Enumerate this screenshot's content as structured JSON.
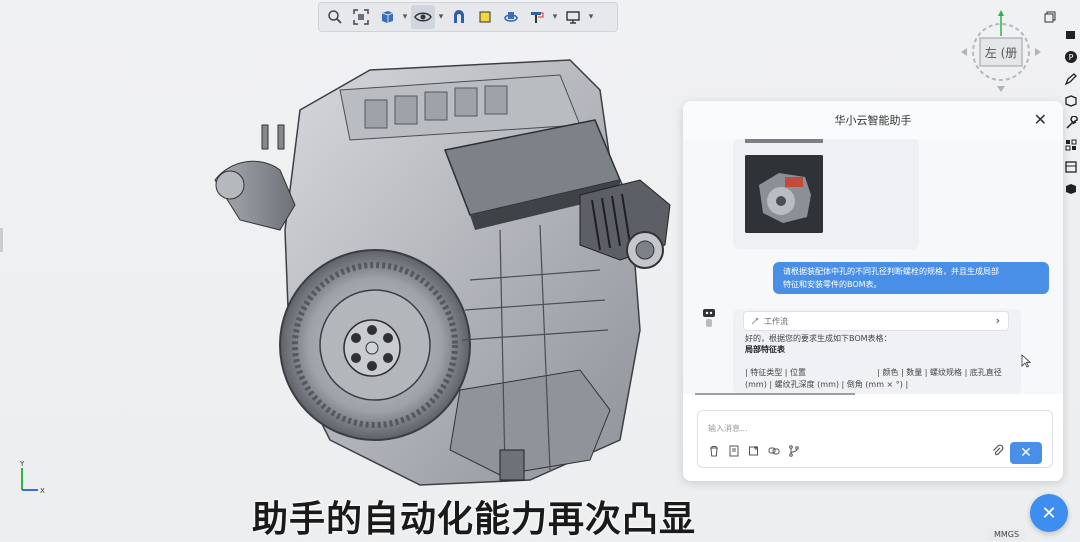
{
  "toolbar": {
    "icons": [
      "zoom-icon",
      "fit-view-icon",
      "cube-view-icon",
      "eye-icon",
      "section-icon",
      "face-icon",
      "rotate-icon",
      "paint-icon",
      "display-icon"
    ]
  },
  "viewcube": {
    "label": "左 (册"
  },
  "axis": {
    "y": "Y",
    "x": "X"
  },
  "subtitle": "助手的自动化能力再次凸显",
  "chat": {
    "title": "华小云智能助手",
    "user_message_line1": "请根据装配体中孔的不同孔径判断螺栓的规格，并且生成局部",
    "user_message_line2": "特征和安装零件的BOM表。",
    "workflow_label": "工作流",
    "bot_line1": "好的，根据您的要求生成如下BOM表格：",
    "bot_heading": "局部特征表",
    "bot_table_line1": "| 特征类型 | 位置                            | 颜色 | 数量 | 螺纹规格 | 底孔直径",
    "bot_table_line2": "(mm) | 螺纹孔深度 (mm) | 倒角 (mm × °) |",
    "input_placeholder": "输入消息..."
  },
  "units": "MMGS",
  "colors": {
    "accent": "#4a8fe7",
    "fab": "#3d8ef0"
  }
}
